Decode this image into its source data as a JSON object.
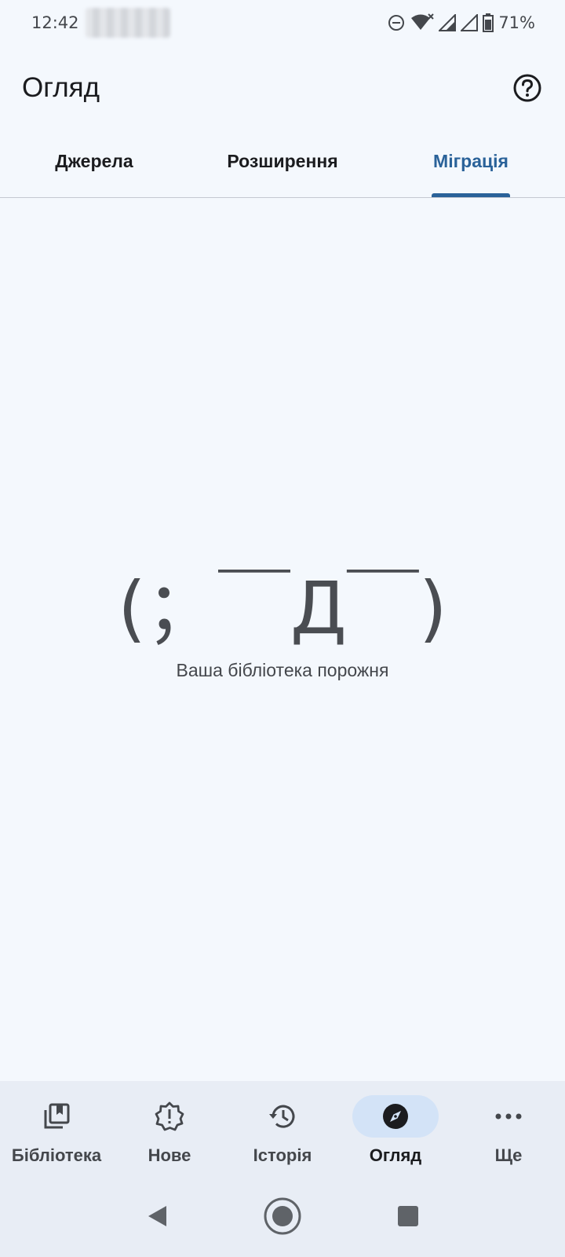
{
  "status": {
    "time": "12:42",
    "battery": "71%"
  },
  "app_bar": {
    "title": "Огляд"
  },
  "tabs": [
    {
      "label": "Джерела"
    },
    {
      "label": "Розширення"
    },
    {
      "label": "Міграція"
    }
  ],
  "active_tab": "Міграція",
  "empty_state": {
    "kaomoji": "(；￣Д￣)",
    "message": "Ваша бібліотека порожня"
  },
  "bottom_nav": [
    {
      "label": "Бібліотека",
      "icon": "library-icon"
    },
    {
      "label": "Нове",
      "icon": "updates-icon"
    },
    {
      "label": "Історія",
      "icon": "history-icon"
    },
    {
      "label": "Огляд",
      "icon": "compass-icon"
    },
    {
      "label": "Ще",
      "icon": "more-icon"
    }
  ],
  "active_nav": "Огляд",
  "colors": {
    "accent": "#2a6299",
    "background": "#f4f8fd",
    "nav_background": "#e8edf5",
    "active_pill": "#d3e3f7"
  }
}
